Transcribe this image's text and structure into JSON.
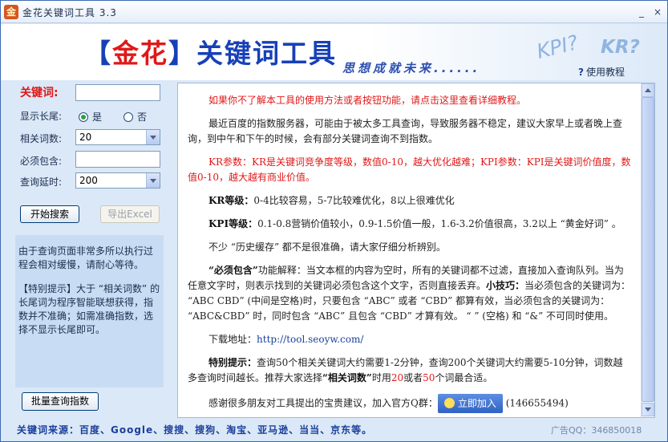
{
  "window": {
    "title": "金花关键词工具 3.3",
    "app_icon": "金",
    "minimize": "_",
    "close": "×"
  },
  "banner": {
    "title_open": "【",
    "title_brand": "金花",
    "title_close": "】关键词工具",
    "slogan": "思想成就未来......",
    "kpi": "KPI?",
    "kr": "KR?",
    "help_q": "?",
    "help_label": "使用教程"
  },
  "form": {
    "keyword_label": "关键词:",
    "keyword_value": "",
    "longtail_label": "显示长尾:",
    "longtail_yes": "是",
    "longtail_no": "否",
    "related_label": "相关词数:",
    "related_value": "20",
    "must_include_label": "必须包含:",
    "must_include_value": "",
    "delay_label": "查询延时:",
    "delay_value": "200",
    "start_button": "开始搜索",
    "export_button": "导出Excel",
    "batch_button": "批量查询指数"
  },
  "info": {
    "p1": "由于查询页面非常多所以执行过程会相对缓慢，请耐心等待。",
    "p2": "【特别提示】大于 “相关词数” 的长尾词为程序智能联想获得，指数并不准确；如需准确指数，选择不显示长尾即可。"
  },
  "content": {
    "p1": "如果你不了解本工具的使用方法或者按钮功能，请点击这里查看详细教程。",
    "p2": "最近百度的指数服务器，可能由于被太多工具查询，导致服务器不稳定，建议大家早上或者晚上查询，到中午和下午的时候，会有部分关键词查询不到指数。",
    "p3": "KR参数：KR是关键词竞争度等级，数值0-10，越大优化越难；KPI参数：KPI是关键词价值度，数值0-10，越大越有商业价值。",
    "p4_label": "KR等级：",
    "p4_text": "0-4比较容易，5-7比较难优化，8以上很难优化",
    "p5_label": "KPI等级：",
    "p5_text": "0.1-0.8营销价值较小，0.9-1.5价值一般，1.6-3.2价值很高，3.2以上 “黄金好词” 。",
    "p6": "不少 “历史缓存” 都不是很准确，请大家仔细分析辨别。",
    "p7_label": "“必须包含”",
    "p7_text": "功能解释：当文本框的内容为空时，所有的关键词都不过滤，直接加入查询队列。当为任意文字时，则表示找到的关键词必须包含这个文字，否则直接丢弃。",
    "p7_tip_label": "小技巧：",
    "p7_tip_text": "当必须包含的关键词为： “ABC CBD” (中间是空格)时，只要包含 “ABC” 或者 “CBD” 都算有效，当必须包含的关键词为： “ABC&CBD” 时，同时包含 “ABC” 且包含 “CBD” 才算有效。 “ ” (空格) 和 “&” 不可同时使用。",
    "p8_label": "下载地址：",
    "p8_link": "http://tool.seoyw.com/",
    "p9_label": "特别提示：",
    "p9_text_a": "查询50个相关关键词大约需要1-2分钟，查询200个关键词大约需要5-10分钟，词数越多查询时间越长。推荐大家选择",
    "p9_related": "“相关词数”",
    "p9_text_b": "时用",
    "p9_num20": "20",
    "p9_or": "或者",
    "p9_num50": "50",
    "p9_text_c": "个词最合适。",
    "p10_text": "感谢很多朋友对工具提出的宝贵建议，加入官方Q群：",
    "join_button": "立即加入",
    "qq_group": "(146655494)"
  },
  "footer": {
    "sources": "关键词来源：百度、Google、搜搜、搜狗、淘宝、亚马逊、当当、京东等。",
    "ad": "广告QQ：346850018"
  },
  "colors": {
    "accent_blue": "#1740b8",
    "brand_red": "#e01818",
    "panel_bg": "#dbe8f7"
  }
}
